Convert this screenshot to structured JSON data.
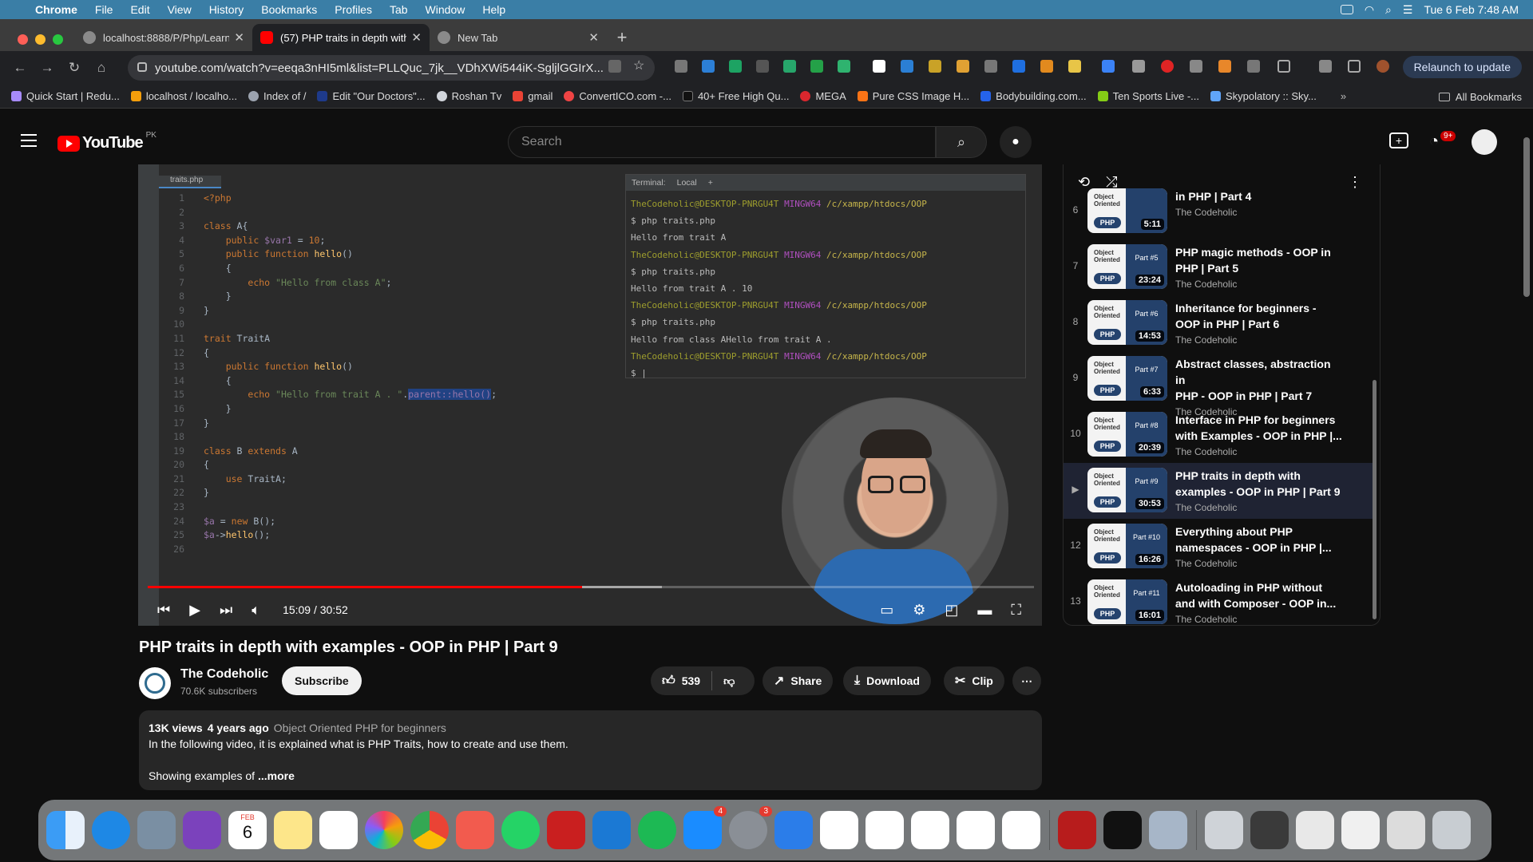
{
  "menubar": {
    "app": "Chrome",
    "items": [
      "File",
      "Edit",
      "View",
      "History",
      "Bookmarks",
      "Profiles",
      "Tab",
      "Window",
      "Help"
    ],
    "clock": "Tue 6 Feb  7:48 AM"
  },
  "tabs": [
    {
      "title": "localhost:8888/P/Php/Learnin",
      "favicon_color": "#8a8a8a"
    },
    {
      "title": "(57) PHP traits in depth with",
      "favicon_color": "#ff0000"
    },
    {
      "title": "New Tab",
      "favicon_color": "#8a8a8a"
    }
  ],
  "toolbar": {
    "url": "youtube.com/watch?v=eeqa3nHI5ml&list=PLLQuc_7jk__VDhXWi544iK-SgljlGGIrX...",
    "relaunch": "Relaunch to update"
  },
  "bookmarks": {
    "items": [
      "Quick Start | Redu...",
      "localhost / localho...",
      "Index of /",
      "Edit \"Our Doctors\"...",
      "Roshan Tv",
      "gmail",
      "ConvertICO.com -...",
      "40+ Free High Qu...",
      "MEGA",
      "Pure CSS Image H...",
      "Bodybuilding.com...",
      "Ten Sports Live -...",
      "Skypolatory :: Sky..."
    ],
    "all": "All Bookmarks"
  },
  "youtube": {
    "logo": "YouTube",
    "region": "PK",
    "search_placeholder": "Search",
    "notification_count": "9+"
  },
  "player": {
    "file_tab": "traits.php",
    "terminal_label": "Terminal:",
    "terminal_tab": "Local",
    "terminal_lines": [
      {
        "kind": "prompt",
        "user": "TheCodeholic@DESKTOP-PNRGU4T",
        "env": "MINGW64",
        "path": "/c/xampp/htdocs/OOP"
      },
      {
        "kind": "out",
        "text": "$ php traits.php"
      },
      {
        "kind": "out",
        "text": "Hello from trait A"
      },
      {
        "kind": "prompt",
        "user": "TheCodeholic@DESKTOP-PNRGU4T",
        "env": "MINGW64",
        "path": "/c/xampp/htdocs/OOP"
      },
      {
        "kind": "out",
        "text": "$ php traits.php"
      },
      {
        "kind": "out",
        "text": "Hello from trait A . 10"
      },
      {
        "kind": "prompt",
        "user": "TheCodeholic@DESKTOP-PNRGU4T",
        "env": "MINGW64",
        "path": "/c/xampp/htdocs/OOP"
      },
      {
        "kind": "out",
        "text": "$ php traits.php"
      },
      {
        "kind": "out",
        "text": "Hello from class AHello from trait A ."
      },
      {
        "kind": "prompt",
        "user": "TheCodeholic@DESKTOP-PNRGU4T",
        "env": "MINGW64",
        "path": "/c/xampp/htdocs/OOP"
      },
      {
        "kind": "out",
        "text": "$ |"
      }
    ],
    "time": "15:09 / 30:52",
    "progress_played": 0.49,
    "progress_buffered": 0.58
  },
  "video": {
    "title": "PHP traits in depth with examples - OOP in PHP | Part 9",
    "channel": "The Codeholic",
    "subscribers": "70.6K subscribers",
    "subscribe": "Subscribe",
    "likes": "539",
    "share": "Share",
    "download": "Download",
    "clip": "Clip",
    "views": "13K views",
    "age": "4 years ago",
    "playlist_link": "Object Oriented PHP for beginners",
    "description1": "In the following video, it is explained what is PHP Traits, how to create and use them.",
    "description2": "Showing examples of",
    "more": "...more"
  },
  "playlist": {
    "items": [
      {
        "idx": "6",
        "title": "in PHP | Part 4",
        "title2": "",
        "channel": "The Codeholic",
        "duration": "5:11",
        "part": ""
      },
      {
        "idx": "7",
        "title": "PHP magic methods - OOP in",
        "title2": "PHP | Part 5",
        "channel": "The Codeholic",
        "duration": "23:24",
        "part": "Part #5"
      },
      {
        "idx": "8",
        "title": "Inheritance for beginners -",
        "title2": "OOP in PHP | Part 6",
        "channel": "The Codeholic",
        "duration": "14:53",
        "part": "Part #6"
      },
      {
        "idx": "9",
        "title": "Abstract classes, abstraction in",
        "title2": "PHP - OOP in PHP | Part 7",
        "channel": "The Codeholic",
        "duration": "6:33",
        "part": "Part #7"
      },
      {
        "idx": "10",
        "title": "Interface in PHP for beginners",
        "title2": "with Examples - OOP in PHP |...",
        "channel": "The Codeholic",
        "duration": "20:39",
        "part": "Part #8"
      },
      {
        "idx": "▶",
        "title": "PHP traits in depth with",
        "title2": "examples - OOP in PHP | Part 9",
        "channel": "The Codeholic",
        "duration": "30:53",
        "part": "Part #9"
      },
      {
        "idx": "12",
        "title": "Everything about PHP",
        "title2": "namespaces - OOP in PHP |...",
        "channel": "The Codeholic",
        "duration": "16:26",
        "part": "Part #10"
      },
      {
        "idx": "13",
        "title": "Autoloading in PHP without",
        "title2": "and with Composer - OOP in...",
        "channel": "The Codeholic",
        "duration": "16:01",
        "part": "Part #11"
      }
    ],
    "thumb_label_1": "Object",
    "thumb_label_2": "Oriented",
    "thumb_php": "PHP"
  },
  "dock": {
    "calendar_month": "FEB",
    "calendar_day": "6",
    "appstore_badge": "4",
    "settings_badge": "3"
  }
}
